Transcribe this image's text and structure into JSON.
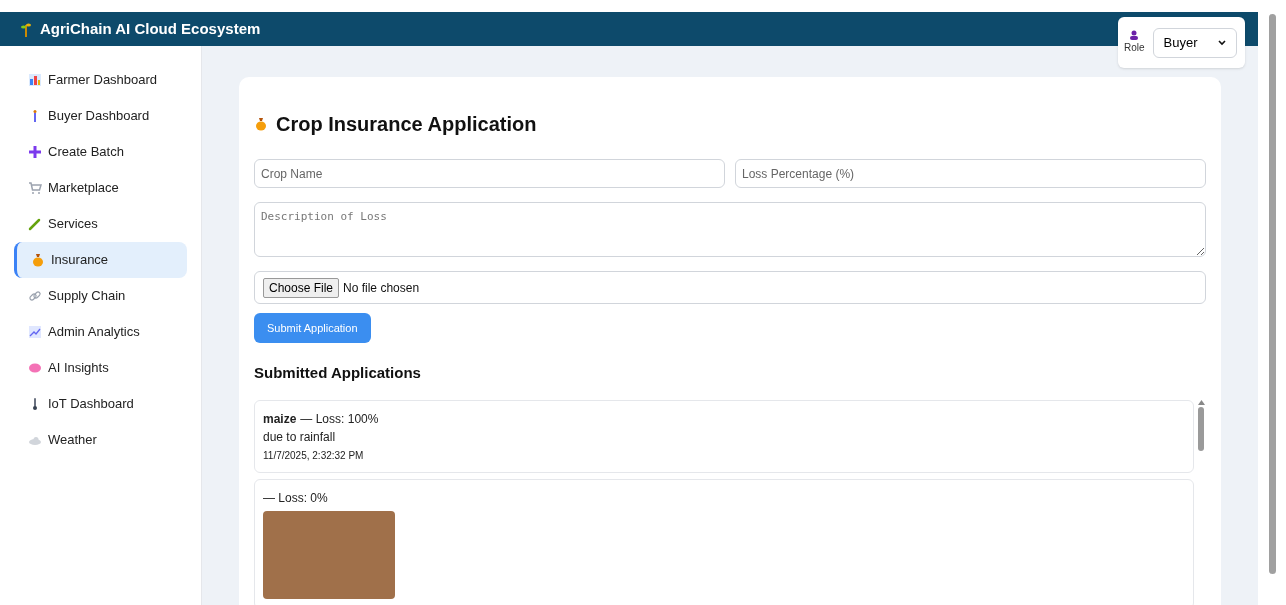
{
  "header": {
    "title": "AgriChain AI Cloud Ecosystem"
  },
  "role": {
    "label": "Role",
    "value": "Buyer"
  },
  "sidebar": {
    "items": [
      {
        "label": "Farmer Dashboard",
        "selected": false
      },
      {
        "label": "Buyer Dashboard",
        "selected": false
      },
      {
        "label": "Create Batch",
        "selected": false
      },
      {
        "label": "Marketplace",
        "selected": false
      },
      {
        "label": "Services",
        "selected": false
      },
      {
        "label": "Insurance",
        "selected": true
      },
      {
        "label": "Supply Chain",
        "selected": false
      },
      {
        "label": "Admin Analytics",
        "selected": false
      },
      {
        "label": "AI Insights",
        "selected": false
      },
      {
        "label": "IoT Dashboard",
        "selected": false
      },
      {
        "label": "Weather",
        "selected": false
      }
    ]
  },
  "form": {
    "title": "Crop Insurance Application",
    "crop_name": {
      "placeholder": "Crop Name"
    },
    "loss_percentage": {
      "placeholder": "Loss Percentage (%)"
    },
    "description": {
      "placeholder": "Description of Loss"
    },
    "file": {
      "button": "Choose File",
      "status": "No file chosen"
    },
    "submit": "Submit Application"
  },
  "applications": {
    "title": "Submitted Applications",
    "items": [
      {
        "kind": "text",
        "crop": "maize",
        "loss": "— Loss: 100%",
        "description": "due to rainfall",
        "time": "11/7/2025, 2:32:32 PM"
      },
      {
        "kind": "photo",
        "loss": "— Loss: 0%"
      }
    ]
  }
}
